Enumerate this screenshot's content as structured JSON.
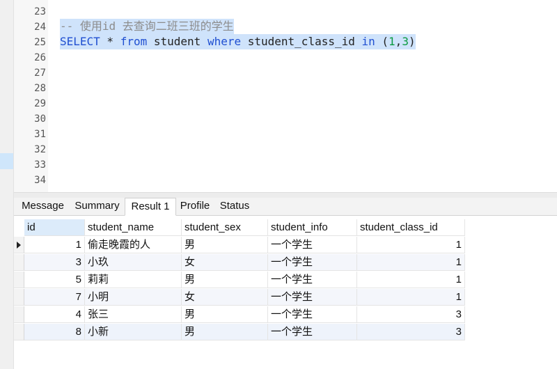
{
  "editor": {
    "line_numbers": [
      "23",
      "24",
      "25",
      "26",
      "27",
      "28",
      "29",
      "30",
      "31",
      "32",
      "33",
      "34"
    ],
    "comment_line": "-- 使用id 去查询二班三班的学生",
    "sql": {
      "kw1": "SELECT",
      "star": " * ",
      "kw2": "from",
      "table": " student ",
      "kw3": "where",
      "col": " student_class_id ",
      "kw4": "in",
      "open": " (",
      "n1": "1",
      "comma": ",",
      "n2": "3",
      "close": ")"
    }
  },
  "tabs": [
    "Message",
    "Summary",
    "Result 1",
    "Profile",
    "Status"
  ],
  "active_tab": "Result 1",
  "grid": {
    "columns": [
      "id",
      "student_name",
      "student_sex",
      "student_info",
      "student_class_id"
    ],
    "rows": [
      {
        "id": "1",
        "name": "偷走晚霞的人",
        "sex": "男",
        "info": "一个学生",
        "class_id": "1"
      },
      {
        "id": "3",
        "name": "小玖",
        "sex": "女",
        "info": "一个学生",
        "class_id": "1"
      },
      {
        "id": "5",
        "name": "莉莉",
        "sex": "男",
        "info": "一个学生",
        "class_id": "1"
      },
      {
        "id": "7",
        "name": "小明",
        "sex": "女",
        "info": "一个学生",
        "class_id": "1"
      },
      {
        "id": "4",
        "name": "张三",
        "sex": "男",
        "info": "一个学生",
        "class_id": "3"
      },
      {
        "id": "8",
        "name": "小新",
        "sex": "男",
        "info": "一个学生",
        "class_id": "3"
      }
    ]
  }
}
